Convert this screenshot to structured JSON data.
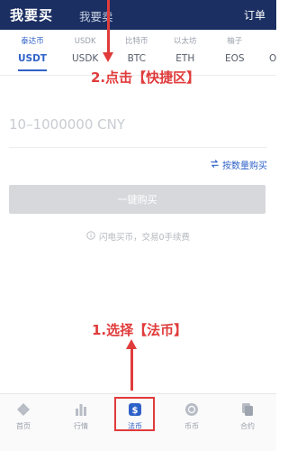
{
  "header": {
    "tab_buy": "我要买",
    "tab_sell": "我要卖",
    "orders": "订单"
  },
  "coins": [
    {
      "cn": "泰达币",
      "sym": "USDT",
      "active": true
    },
    {
      "cn": "USDK",
      "sym": "USDK",
      "active": false
    },
    {
      "cn": "比特币",
      "sym": "BTC",
      "active": false
    },
    {
      "cn": "以太坊",
      "sym": "ETH",
      "active": false
    },
    {
      "cn": "柚子",
      "sym": "EOS",
      "active": false
    },
    {
      "cn": "",
      "sym": "O",
      "active": false
    }
  ],
  "amount": {
    "value": "",
    "placeholder": "10–1000000 CNY"
  },
  "switch_link": "按数量购买",
  "buy_button": "一键购买",
  "note": "闪电买币，交易0手续费",
  "annotations": {
    "step2": "2.点击【快捷区】",
    "step1": "1.选择【法币】"
  },
  "bottom_nav": [
    {
      "label": "首页",
      "icon": "home-icon"
    },
    {
      "label": "行情",
      "icon": "market-icon"
    },
    {
      "label": "法币",
      "icon": "fiat-icon",
      "active": true
    },
    {
      "label": "币币",
      "icon": "coin-icon"
    },
    {
      "label": "合约",
      "icon": "contract-icon"
    }
  ],
  "colors": {
    "header_bg": "#1b2f62",
    "accent": "#2f62c8",
    "annotation": "#e03b3b",
    "button_disabled": "#d6d8dc"
  }
}
